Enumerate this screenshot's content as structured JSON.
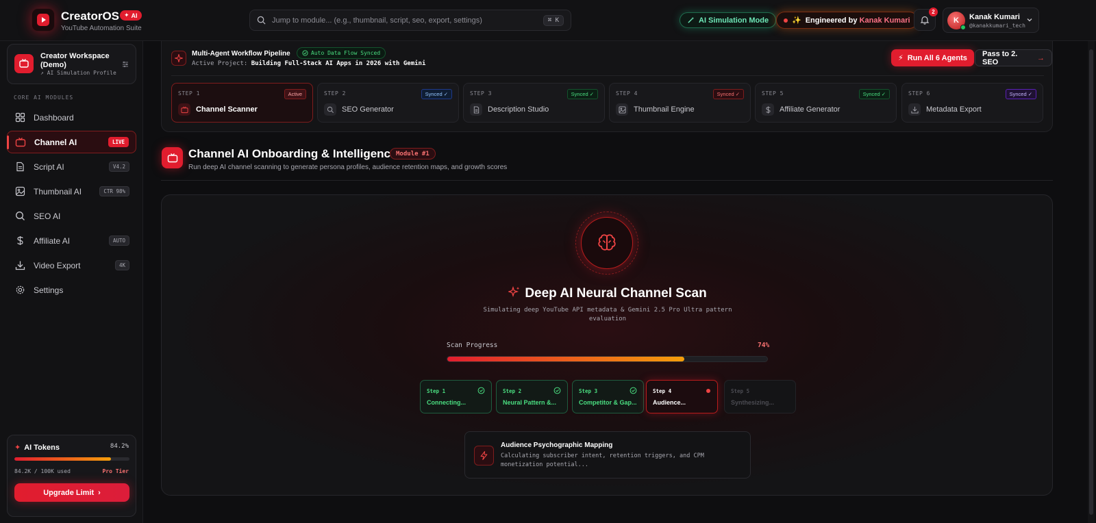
{
  "app": {
    "title": "CreatorOS",
    "ai_badge": "AI",
    "subtitle": "YouTube Automation Suite",
    "brand_color": "#e11d2e"
  },
  "search": {
    "placeholder": "Jump to module... (e.g., thumbnail, script, seo, export, settings)",
    "shortcut": "⌘ K"
  },
  "header": {
    "sim_mode": "AI Simulation Mode",
    "engineered_prefix": "Engineered by ",
    "engineered_name": "Kanak Kumari",
    "notifications_count": "2",
    "user_name": "Kanak Kumari",
    "user_handle": "@kanakkumari_tech",
    "user_initial": "K"
  },
  "workspace": {
    "title": "Creator Workspace (Demo)",
    "subtitle": "↗ AI Simulation Profile"
  },
  "sidebar": {
    "section_label": "CORE AI MODULES",
    "items": [
      {
        "label": "Dashboard",
        "tag": "",
        "icon": "grid-icon",
        "active": false
      },
      {
        "label": "Channel AI",
        "tag": "LIVE",
        "icon": "tv-icon",
        "active": true
      },
      {
        "label": "Script AI",
        "tag": "V4.2",
        "icon": "file-icon",
        "active": false
      },
      {
        "label": "Thumbnail AI",
        "tag": "CTR 98%",
        "icon": "image-icon",
        "active": false
      },
      {
        "label": "SEO AI",
        "tag": "",
        "icon": "search-icon",
        "active": false
      },
      {
        "label": "Affiliate AI",
        "tag": "AUTO",
        "icon": "dollar-icon",
        "active": false
      },
      {
        "label": "Video Export",
        "tag": "4K",
        "icon": "download-icon",
        "active": false
      },
      {
        "label": "Settings",
        "tag": "",
        "icon": "gear-icon",
        "active": false
      }
    ]
  },
  "tokens": {
    "title": "AI Tokens",
    "percent": "84.2%",
    "fill_fraction": 0.842,
    "used": "84.2K / 100K used",
    "tier": "Pro Tier",
    "upgrade_label": "Upgrade Limit"
  },
  "pipeline": {
    "title": "Multi-Agent Workflow Pipeline",
    "sync_status": "Auto Data Flow Synced",
    "project_prefix": "Active Project:",
    "project_name": "Building Full-Stack AI Apps in 2026 with Gemini",
    "run_all_label": "Run All 6 Agents",
    "pass_label": "Pass to 2. SEO",
    "steps": [
      {
        "num": "STEP 1",
        "badge": "Active",
        "label": "Channel Scanner",
        "icon": "tv-icon"
      },
      {
        "num": "STEP 2",
        "badge": "Synced ✓",
        "label": "SEO Generator",
        "icon": "search-icon"
      },
      {
        "num": "STEP 3",
        "badge": "Synced ✓",
        "label": "Description Studio",
        "icon": "file-icon"
      },
      {
        "num": "STEP 4",
        "badge": "Synced ✓",
        "label": "Thumbnail Engine",
        "icon": "image-icon"
      },
      {
        "num": "STEP 5",
        "badge": "Synced ✓",
        "label": "Affiliate Generator",
        "icon": "dollar-icon"
      },
      {
        "num": "STEP 6",
        "badge": "Synced ✓",
        "label": "Metadata Export",
        "icon": "download-icon"
      }
    ]
  },
  "module": {
    "title": "Channel AI Onboarding & Intelligence",
    "badge": "Module #1",
    "subtitle": "Run deep AI channel scanning to generate persona profiles, audience retention maps, and growth scores"
  },
  "scan": {
    "title": "Deep AI Neural Channel Scan",
    "subtitle": "Simulating deep YouTube API metadata & Gemini 2.5 Pro Ultra pattern evaluation",
    "progress_label": "Scan Progress",
    "progress_text": "74%",
    "progress_fraction": 0.74,
    "steps": [
      {
        "label": "Step 1",
        "text": "Connecting...",
        "state": "done"
      },
      {
        "label": "Step 2",
        "text": "Neural Pattern &...",
        "state": "done"
      },
      {
        "label": "Step 3",
        "text": "Competitor & Gap...",
        "state": "done"
      },
      {
        "label": "Step 4",
        "text": "Audience...",
        "state": "current"
      },
      {
        "label": "Step 5",
        "text": "Synthesizing...",
        "state": "pending"
      }
    ],
    "detail_title": "Audience Psychographic Mapping",
    "detail_text": "Calculating subscriber intent, retention triggers, and CPM monetization potential..."
  }
}
